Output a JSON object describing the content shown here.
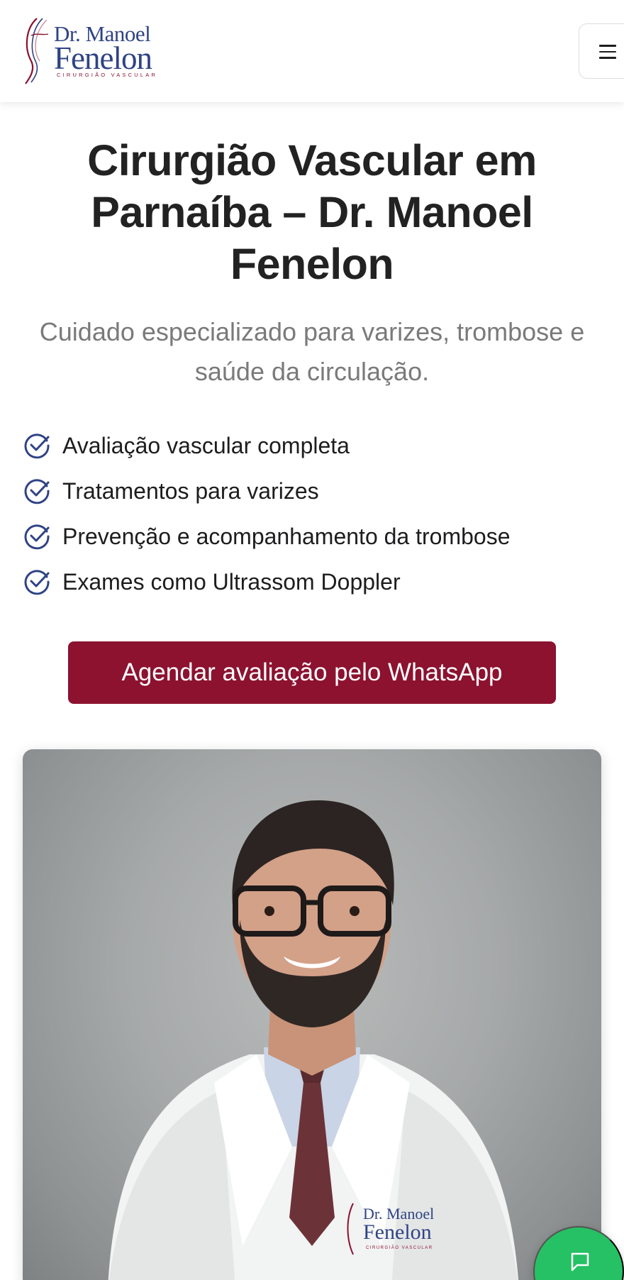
{
  "header": {
    "logo": {
      "line1": "Dr. Manoel",
      "line2": "Fenelon",
      "tagline": "CIRURGIÃO VASCULAR"
    },
    "menu_icon": "hamburger-menu-icon"
  },
  "hero": {
    "title": "Cirurgião Vascular em Parnaíba – Dr. Manoel Fenelon",
    "subtitle": "Cuidado especializado para varizes, trombose e saúde da circulação.",
    "features": [
      "Avaliação vascular completa",
      "Tratamentos para varizes",
      "Prevenção e acompanhamento da trombose",
      "Exames como Ultrassom Doppler"
    ],
    "feature_icon": "check-circle-icon",
    "cta_label": "Agendar avaliação pelo WhatsApp"
  },
  "photo": {
    "coat_logo_line1": "Dr. Manoel",
    "coat_logo_line2": "Fenelon",
    "coat_logo_tagline": "CIRURGIÃO VASCULAR"
  },
  "chat_fab": {
    "icon": "chat-bubble-icon"
  },
  "colors": {
    "brand_navy": "#2f4385",
    "brand_wine": "#8c1230",
    "whatsapp_green": "#25c164"
  }
}
